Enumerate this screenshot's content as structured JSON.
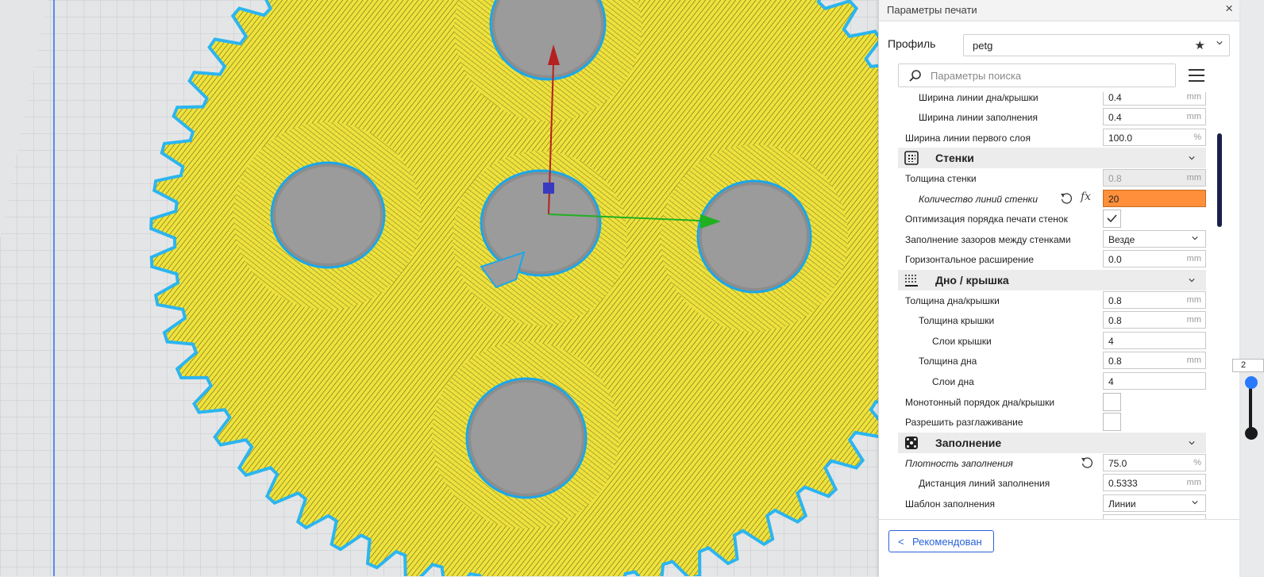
{
  "panel": {
    "title": "Параметры печати",
    "close_glyph": "×",
    "profile_label": "Профиль",
    "profile_value": "petg",
    "search_placeholder": "Параметры поиска"
  },
  "settings": [
    {
      "label": "Ширина линии дна/крышки",
      "value": "0.4",
      "unit": "mm"
    },
    {
      "label": "Ширина линии заполнения",
      "value": "0.4",
      "unit": "mm"
    },
    {
      "label": "Ширина линии первого слоя",
      "value": "100.0",
      "unit": "%"
    },
    {
      "category": "Стенки",
      "icon": "walls-icon"
    },
    {
      "label": "Толщина стенки",
      "value": "0.8",
      "unit": "mm",
      "disabled": true
    },
    {
      "label": "Количество линий стенки",
      "value": "20",
      "highlight": "#ff8f3a"
    },
    {
      "label": "Оптимизация порядка печати стенок",
      "checked": true
    },
    {
      "label": "Заполнение зазоров между стенками",
      "value": "Везде"
    },
    {
      "label": "Горизонтальное расширение",
      "value": "0.0",
      "unit": "mm"
    },
    {
      "category": "Дно / крышка",
      "icon": "top-bottom-icon"
    },
    {
      "label": "Толщина дна/крышки",
      "value": "0.8",
      "unit": "mm"
    },
    {
      "label": "Толщина крышки",
      "value": "0.8",
      "unit": "mm"
    },
    {
      "label": "Слои крышки",
      "value": "4"
    },
    {
      "label": "Толщина дна",
      "value": "0.8",
      "unit": "mm"
    },
    {
      "label": "Слои дна",
      "value": "4"
    },
    {
      "label": "Монотонный порядок дна/крышки",
      "checked": false
    },
    {
      "label": "Разрешить разглаживание",
      "checked": false
    },
    {
      "category": "Заполнение",
      "icon": "infill-icon"
    },
    {
      "label": "Плотность заполнения",
      "value": "75.0",
      "unit": "%"
    },
    {
      "label": "Дистанция линий заполнения",
      "value": "0.5333",
      "unit": "mm"
    },
    {
      "label": "Шаблон заполнения",
      "value": "Линии"
    }
  ],
  "footer": {
    "recommended_arrow": "<",
    "recommended_label": "Рекомендован"
  },
  "layer_slider": {
    "value": "2"
  },
  "colors": {
    "filament": "#f0e441",
    "outer_wall": "#2bb5f0",
    "build_plate": "#e9eaeb",
    "axis_x": "#20b020",
    "axis_y": "#c02020",
    "axis_z": "#3030c0",
    "accent": "#2b63d9"
  }
}
